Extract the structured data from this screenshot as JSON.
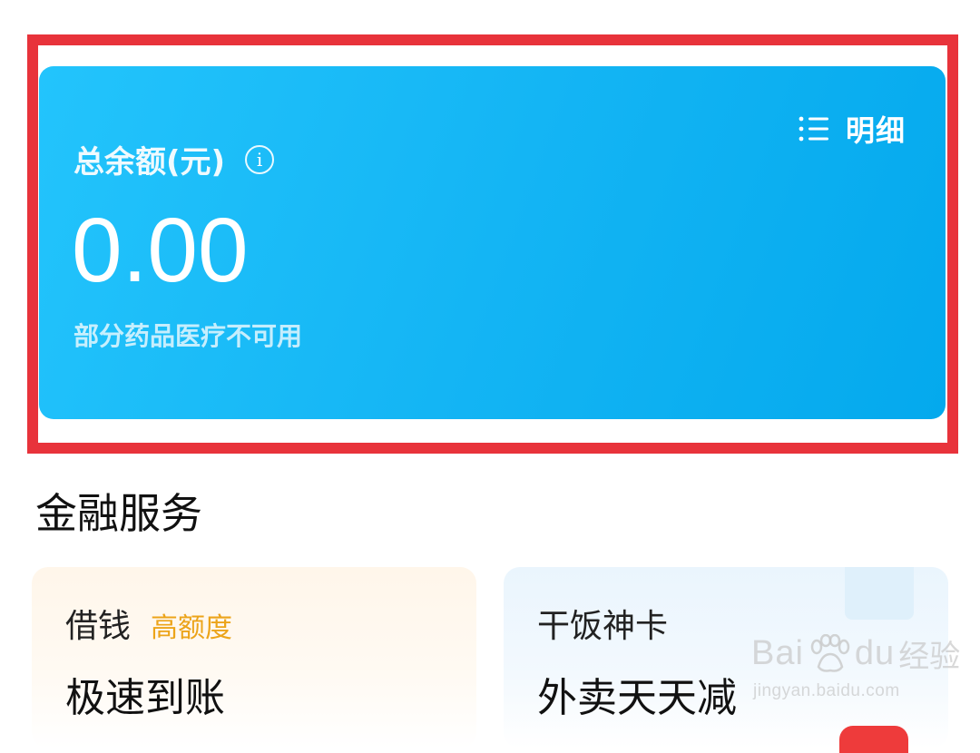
{
  "balance_card": {
    "title": "总余额(元)",
    "info_icon": "info-icon",
    "detail_label": "明细",
    "detail_icon": "list-icon",
    "amount": "0.00",
    "note": "部分药品医疗不可用"
  },
  "finance": {
    "section_title": "金融服务",
    "cards": [
      {
        "name": "借钱",
        "tag": "高额度",
        "headline": "极速到账"
      },
      {
        "name": "干饭神卡",
        "tag": "",
        "headline": "外卖天天减"
      }
    ]
  },
  "watermark": {
    "brand_left": "Bai",
    "brand_right": "du",
    "brand_cn": "经验",
    "url": "jingyan.baidu.com"
  },
  "colors": {
    "card_blue": "#14b5f4",
    "highlight_red": "#e8333b",
    "tag_orange": "#eca41a"
  }
}
